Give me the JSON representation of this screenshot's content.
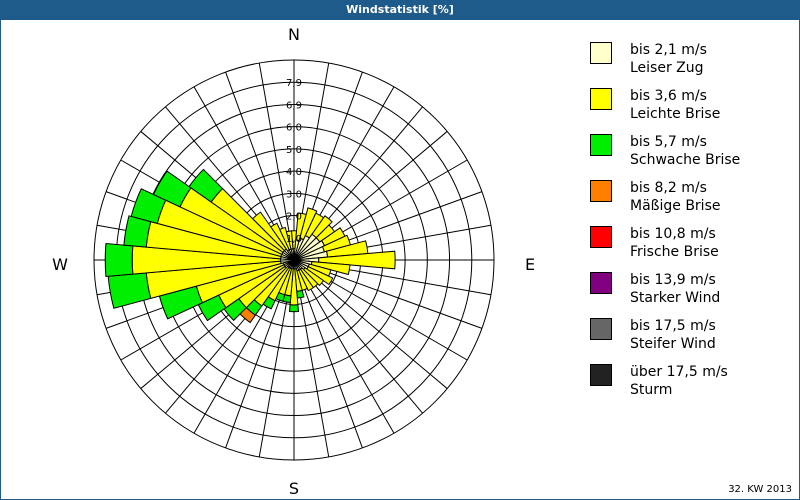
{
  "header": {
    "title": "Windstatistik [%]"
  },
  "footer": {
    "week_label": "32. KW 2013"
  },
  "chart_data": {
    "type": "wind-rose",
    "title": "Windstatistik [%]",
    "compass_labels": {
      "n": "N",
      "e": "E",
      "s": "S",
      "w": "W"
    },
    "radial_max": 8.9,
    "ring_count": 9,
    "radial_tick_labels": [
      "1,0",
      "2,0",
      "3,0",
      "4,0",
      "5,0",
      "6,0",
      "6,9",
      "7,9"
    ],
    "directions_deg": [
      0,
      10,
      20,
      30,
      40,
      50,
      60,
      70,
      80,
      90,
      100,
      110,
      120,
      130,
      140,
      150,
      160,
      170,
      180,
      190,
      200,
      210,
      220,
      230,
      240,
      250,
      260,
      270,
      280,
      290,
      300,
      310,
      320,
      330,
      340,
      350
    ],
    "series": [
      {
        "name": "bis 2,1 m/s",
        "values": [
          0.5,
          0.9,
          1.0,
          1.2,
          1.4,
          1.4,
          1.5,
          1.4,
          1.5,
          1.1,
          0.8,
          0.7,
          0.7,
          0.6,
          0.5,
          0.5,
          0.5,
          0.4,
          0.4,
          0.4,
          0.4,
          0.4,
          0.4,
          0.5,
          0.5,
          0.5,
          0.6,
          0.6,
          0.6,
          0.6,
          0.6,
          0.6,
          0.6,
          0.5,
          0.5,
          0.5
        ]
      },
      {
        "name": "bis 3,6 m/s",
        "values": [
          0.8,
          1.2,
          1.4,
          1.1,
          1.0,
          0.8,
          1.0,
          1.2,
          1.8,
          3.4,
          1.7,
          1.0,
          1.2,
          1.0,
          1.0,
          1.0,
          0.9,
          1.0,
          1.6,
          1.2,
          1.2,
          1.6,
          2.1,
          2.5,
          3.2,
          4.0,
          6.0,
          6.6,
          6.0,
          5.7,
          5.0,
          3.9,
          2.0,
          1.3,
          1.0,
          0.8
        ]
      },
      {
        "name": "bis 5,7 m/s",
        "values": [
          0,
          0,
          0,
          0,
          0,
          0,
          0,
          0,
          0,
          0,
          0,
          0,
          0,
          0,
          0,
          0,
          0,
          0.3,
          0.3,
          0.3,
          0.3,
          0.4,
          0.5,
          0.8,
          1.0,
          1.7,
          1.7,
          1.2,
          1.0,
          1.2,
          1.3,
          1.2,
          0,
          0,
          0,
          0
        ]
      },
      {
        "name": "bis 8,2 m/s",
        "values": [
          0,
          0,
          0,
          0,
          0,
          0,
          0,
          0,
          0,
          0,
          0,
          0,
          0,
          0,
          0,
          0,
          0,
          0,
          0,
          0,
          0,
          0,
          0.4,
          0,
          0,
          0,
          0,
          0,
          0,
          0,
          0,
          0,
          0,
          0,
          0,
          0
        ]
      },
      {
        "name": "bis 10,8 m/s",
        "values": [
          0,
          0,
          0,
          0,
          0,
          0,
          0,
          0,
          0,
          0,
          0,
          0,
          0,
          0,
          0,
          0,
          0,
          0,
          0,
          0,
          0,
          0,
          0,
          0,
          0,
          0,
          0,
          0,
          0,
          0,
          0,
          0,
          0,
          0,
          0,
          0
        ]
      },
      {
        "name": "bis 13,9 m/s",
        "values": [
          0,
          0,
          0,
          0,
          0,
          0,
          0,
          0,
          0,
          0,
          0,
          0,
          0,
          0,
          0,
          0,
          0,
          0,
          0,
          0,
          0,
          0,
          0,
          0,
          0,
          0,
          0,
          0,
          0,
          0,
          0,
          0,
          0,
          0,
          0,
          0
        ]
      },
      {
        "name": "bis 17,5 m/s",
        "values": [
          0,
          0,
          0,
          0,
          0,
          0,
          0,
          0,
          0,
          0,
          0,
          0,
          0,
          0,
          0,
          0,
          0,
          0,
          0,
          0,
          0,
          0,
          0,
          0,
          0,
          0,
          0,
          0,
          0,
          0,
          0,
          0,
          0,
          0,
          0,
          0
        ]
      },
      {
        "name": "über 17,5 m/s",
        "values": [
          0,
          0,
          0,
          0,
          0,
          0,
          0,
          0,
          0,
          0,
          0,
          0,
          0,
          0,
          0,
          0,
          0,
          0,
          0,
          0,
          0,
          0,
          0,
          0,
          0,
          0,
          0,
          0,
          0,
          0,
          0,
          0,
          0,
          0,
          0,
          0
        ]
      }
    ],
    "legend": [
      {
        "line1": "bis 2,1 m/s",
        "line2": "Leiser Zug",
        "color": "#ffffcc"
      },
      {
        "line1": "bis 3,6 m/s",
        "line2": "Leichte Brise",
        "color": "#ffff00"
      },
      {
        "line1": "bis 5,7 m/s",
        "line2": "Schwache Brise",
        "color": "#00ee00"
      },
      {
        "line1": "bis 8,2 m/s",
        "line2": "Mäßige Brise",
        "color": "#ff8000"
      },
      {
        "line1": "bis 10,8 m/s",
        "line2": "Frische Brise",
        "color": "#ff0000"
      },
      {
        "line1": "bis 13,9 m/s",
        "line2": "Starker Wind",
        "color": "#800080"
      },
      {
        "line1": "bis 17,5 m/s",
        "line2": "Steifer Wind",
        "color": "#666666"
      },
      {
        "line1": "über 17,5 m/s",
        "line2": "Sturm",
        "color": "#222222"
      }
    ],
    "legend_placement": "right",
    "grid": true
  }
}
